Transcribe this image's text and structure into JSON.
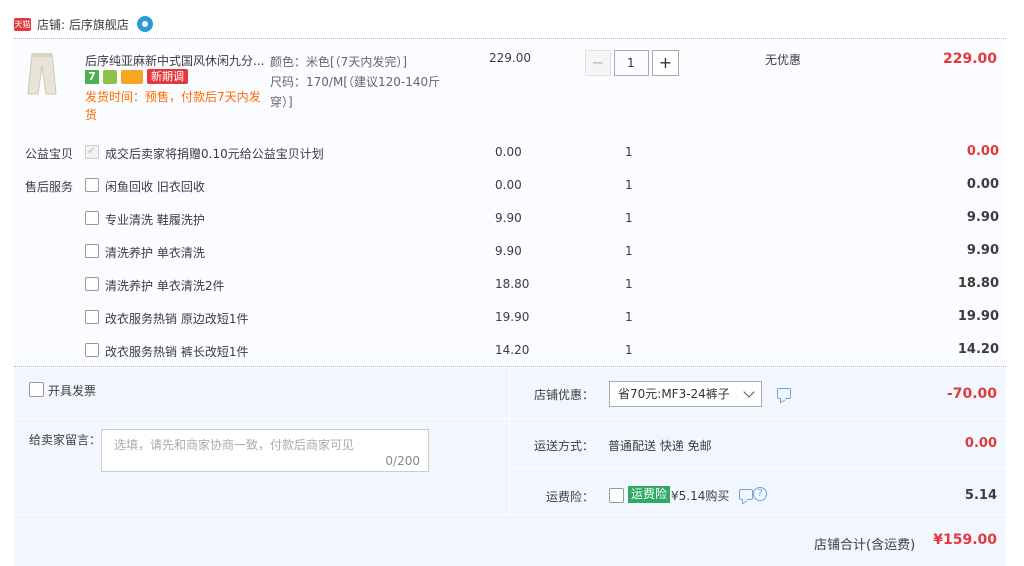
{
  "shop": {
    "badge": "天猫",
    "label": "店铺: 后序旗舰店"
  },
  "item": {
    "title": "后序纯亚麻新中式国风休闲九分...",
    "badge_seven": "7",
    "badge_new": "新期调",
    "ship_note": "发货时间：预售，付款后7天内发货",
    "spec_color": "颜色：米色[（7天内发完）]",
    "spec_size": "尺码：170/M[（建议120-140斤穿）]",
    "price": "229.00",
    "quantity": "1",
    "minus": "−",
    "plus": "+",
    "promo": "无优惠",
    "subtotal": "229.00"
  },
  "services": [
    {
      "group": "公益宝贝",
      "name": "成交后卖家将捐赠0.10元给公益宝贝计划",
      "price": "0.00",
      "qty": "1",
      "total": "0.00",
      "checked": true,
      "red": true
    },
    {
      "group": "售后服务",
      "name": "闲鱼回收 旧衣回收",
      "price": "0.00",
      "qty": "1",
      "total": "0.00",
      "checked": false,
      "red": false
    },
    {
      "group": "",
      "name": "专业清洗 鞋履洗护",
      "price": "9.90",
      "qty": "1",
      "total": "9.90",
      "checked": false,
      "red": false
    },
    {
      "group": "",
      "name": "清洗养护 单衣清洗",
      "price": "9.90",
      "qty": "1",
      "total": "9.90",
      "checked": false,
      "red": false
    },
    {
      "group": "",
      "name": "清洗养护 单衣清洗2件",
      "price": "18.80",
      "qty": "1",
      "total": "18.80",
      "checked": false,
      "red": false
    },
    {
      "group": "",
      "name": "改衣服务热销 原边改短1件",
      "price": "19.90",
      "qty": "1",
      "total": "19.90",
      "checked": false,
      "red": false
    },
    {
      "group": "",
      "name": "改衣服务热销 裤长改短1件",
      "price": "14.20",
      "qty": "1",
      "total": "14.20",
      "checked": false,
      "red": false
    }
  ],
  "invoice": {
    "label": "开具发票"
  },
  "memo": {
    "label": "给卖家留言：",
    "placeholder": "选填，请先和商家协商一致，付款后商家可见",
    "count": "0/200"
  },
  "coupon": {
    "label": "店铺优惠：",
    "selected": "省70元:MF3-24裤子",
    "discount": "-70.00"
  },
  "shipping": {
    "label": "运送方式：",
    "method": "普通配送 快递 免邮",
    "fee": "0.00"
  },
  "insurance": {
    "label": "运费险：",
    "badge": "运费险",
    "price": "¥5.14购买",
    "total": "5.14"
  },
  "total": {
    "label": "店铺合计(含运费)",
    "amount": "¥159.00"
  },
  "colors": {
    "accent_red": "#e4393c",
    "ship_orange": "#ff6a00",
    "insurance_green": "#2eaa64",
    "panel_bg": "#f2f7ff"
  }
}
